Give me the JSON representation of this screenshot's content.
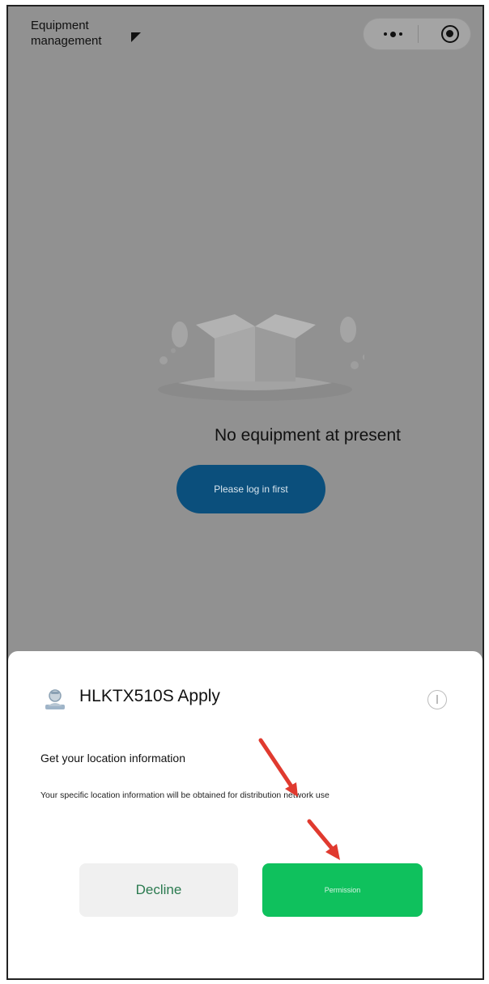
{
  "header": {
    "title_line1": "Equipment",
    "title_line2": "management",
    "more_icon": "more-dots-icon",
    "close_icon": "target-circle-icon"
  },
  "main": {
    "empty_illustration": "empty-box-icon",
    "empty_text": "No equipment at present",
    "login_button_label": "Please log in first"
  },
  "permission_sheet": {
    "app_icon": "app-avatar-icon",
    "app_name": "HLKTX510S Apply",
    "info_icon": "info-icon",
    "title": "Get your location information",
    "description": "Your specific location information will be obtained for distribution network use",
    "decline_label": "Decline",
    "permission_label": "Permission"
  },
  "colors": {
    "overlay_gray": "#919191",
    "login_button": "#0b4f7c",
    "permission_button": "#0fc15d",
    "decline_button": "#f0f0f0",
    "annotation_arrow": "#e03a2f"
  }
}
